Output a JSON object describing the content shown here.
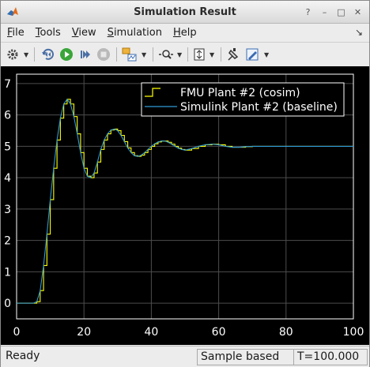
{
  "window": {
    "title": "Simulation Result"
  },
  "menu": {
    "items": [
      {
        "mnemonic": "F",
        "rest": "ile"
      },
      {
        "mnemonic": "T",
        "rest": "ools"
      },
      {
        "mnemonic": "V",
        "rest": "iew"
      },
      {
        "mnemonic": "S",
        "rest": "imulation"
      },
      {
        "mnemonic": "H",
        "rest": "elp"
      }
    ]
  },
  "toolbar": {
    "icons": [
      "settings-icon",
      "step-back-icon",
      "run-icon",
      "step-forward-icon",
      "stop-icon",
      "data-inspector-icon",
      "zoom-icon",
      "autoscale-icon",
      "highlight-icon",
      "style-icon"
    ]
  },
  "chart_data": {
    "type": "line",
    "xlim": [
      0,
      100
    ],
    "ylim": [
      -0.5,
      7.3
    ],
    "x_ticks": [
      "0",
      "20",
      "40",
      "60",
      "80",
      "100"
    ],
    "y_ticks": [
      "0",
      "1",
      "2",
      "3",
      "4",
      "5",
      "6",
      "7"
    ],
    "grid": true,
    "legend_position": "top-right",
    "colors": {
      "background": "#000000",
      "axes": "#ffffff",
      "grid": "#4d4d4d",
      "fmu": "#ffff00",
      "simulink": "#2f9bd8"
    },
    "series": [
      {
        "name": "FMU Plant #2 (cosim)",
        "x": [
          0,
          2,
          4,
          5,
          6,
          7,
          8,
          9,
          10,
          11,
          12,
          13,
          14,
          15,
          16,
          17,
          18,
          19,
          20,
          21,
          22,
          23,
          24,
          25,
          26,
          27,
          28,
          29,
          30,
          31,
          32,
          33,
          34,
          35,
          36,
          37,
          38,
          39,
          40,
          41,
          42,
          43,
          44,
          45,
          46,
          47,
          48,
          49,
          50,
          52,
          54,
          56,
          58,
          60,
          62,
          64,
          66,
          68,
          70,
          75,
          80,
          85,
          90,
          95,
          100
        ],
        "y": [
          0,
          0,
          0,
          0,
          0.05,
          0.4,
          1.2,
          2.2,
          3.3,
          4.3,
          5.2,
          5.9,
          6.35,
          6.5,
          6.35,
          5.95,
          5.4,
          4.8,
          4.3,
          4.05,
          4.0,
          4.15,
          4.5,
          4.9,
          5.2,
          5.4,
          5.52,
          5.55,
          5.5,
          5.35,
          5.15,
          4.95,
          4.8,
          4.7,
          4.68,
          4.72,
          4.8,
          4.9,
          5.0,
          5.08,
          5.14,
          5.17,
          5.17,
          5.13,
          5.07,
          5.0,
          4.94,
          4.9,
          4.88,
          4.93,
          5.0,
          5.05,
          5.07,
          5.05,
          5.0,
          4.97,
          4.97,
          4.99,
          5.0,
          5.0,
          5.0,
          5.0,
          5.0,
          5.0,
          5.0
        ]
      },
      {
        "name": "Simulink Plant #2 (baseline)",
        "x": [
          0,
          2,
          4,
          5,
          6,
          7,
          8,
          9,
          10,
          11,
          12,
          13,
          14,
          15,
          16,
          17,
          18,
          19,
          20,
          21,
          22,
          23,
          24,
          25,
          26,
          27,
          28,
          29,
          30,
          31,
          32,
          33,
          34,
          35,
          36,
          37,
          38,
          39,
          40,
          41,
          42,
          43,
          44,
          45,
          46,
          47,
          48,
          49,
          50,
          52,
          54,
          56,
          58,
          60,
          62,
          64,
          66,
          68,
          70,
          75,
          80,
          85,
          90,
          95,
          100
        ],
        "y": [
          0,
          0,
          0,
          0,
          0.05,
          0.4,
          1.2,
          2.2,
          3.3,
          4.3,
          5.2,
          5.9,
          6.35,
          6.5,
          6.35,
          5.95,
          5.4,
          4.8,
          4.3,
          4.05,
          4.0,
          4.15,
          4.5,
          4.9,
          5.2,
          5.4,
          5.52,
          5.55,
          5.5,
          5.35,
          5.15,
          4.95,
          4.8,
          4.7,
          4.68,
          4.72,
          4.8,
          4.9,
          5.0,
          5.08,
          5.14,
          5.17,
          5.17,
          5.13,
          5.07,
          5.0,
          4.94,
          4.9,
          4.88,
          4.93,
          5.0,
          5.05,
          5.07,
          5.05,
          5.0,
          4.97,
          4.97,
          4.99,
          5.0,
          5.0,
          5.0,
          5.0,
          5.0,
          5.0,
          5.0
        ]
      }
    ]
  },
  "status": {
    "left": "Ready",
    "mode": "Sample based",
    "time": "T=100.000"
  }
}
